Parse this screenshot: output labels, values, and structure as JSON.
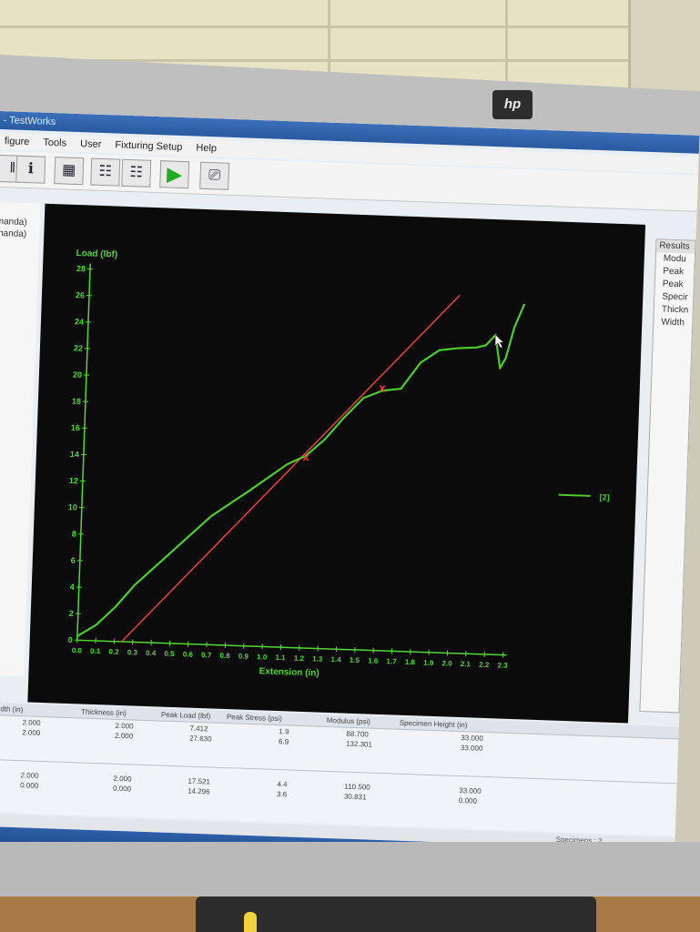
{
  "monitor_brand": "hp",
  "window": {
    "title": "- TestWorks"
  },
  "menu": [
    "figure",
    "Tools",
    "User",
    "Fixturing Setup",
    "Help"
  ],
  "toolbar_icons": [
    "fixture-icon",
    "info-icon",
    "grid-icon",
    "calculator-icon",
    "calculator-icon",
    "play-icon",
    "exit-door-icon"
  ],
  "left_panel": [
    "manda)",
    "manda)"
  ],
  "results_panel": {
    "header": "Results",
    "items": [
      "Modu",
      "Peak",
      "Peak",
      "Specir",
      "Thickn",
      "Width"
    ]
  },
  "chart_data": {
    "type": "line",
    "xlabel": "Extension (in)",
    "ylabel": "Load (lbf)",
    "xlim": [
      0,
      2.3
    ],
    "ylim": [
      0,
      28
    ],
    "x_ticks": [
      "0.0",
      "0.1",
      "0.2",
      "0.3",
      "0.4",
      "0.5",
      "0.6",
      "0.7",
      "0.8",
      "0.9",
      "1.0",
      "1.1",
      "1.2",
      "1.3",
      "1.4",
      "1.5",
      "1.6",
      "1.7",
      "1.8",
      "1.9",
      "2.0",
      "2.1",
      "2.2",
      "2.3"
    ],
    "y_ticks": [
      "0",
      "2",
      "4",
      "6",
      "8",
      "10",
      "12",
      "14",
      "16",
      "18",
      "20",
      "22",
      "24",
      "26",
      "28"
    ],
    "series": [
      {
        "name": "[2]",
        "color": "#4ccd2f",
        "x": [
          0.0,
          0.1,
          0.2,
          0.3,
          0.5,
          0.7,
          0.9,
          1.1,
          1.2,
          1.3,
          1.4,
          1.5,
          1.6,
          1.7,
          1.8,
          1.9,
          2.0,
          2.1,
          2.15,
          2.2,
          2.23,
          2.26,
          2.3,
          2.35
        ],
        "y": [
          0.3,
          1.2,
          2.6,
          4.3,
          7.0,
          9.7,
          11.7,
          13.8,
          14.5,
          15.8,
          17.5,
          19.0,
          19.6,
          19.8,
          21.8,
          22.8,
          23.0,
          23.1,
          23.3,
          24.1,
          21.6,
          22.4,
          24.7,
          26.5
        ]
      }
    ],
    "modulus_line": {
      "color": "#e6443e",
      "x": [
        0.24,
        2.0
      ],
      "y": [
        0.0,
        27.0
      ]
    },
    "markers": [
      {
        "x": 1.2,
        "y": 14.4,
        "label": "x"
      },
      {
        "x": 1.6,
        "y": 19.8,
        "label": "x"
      }
    ],
    "cursor": {
      "x": 2.2,
      "y": 24.1
    }
  },
  "table": {
    "headers": [
      "Width (in)",
      "Thickness (in)",
      "Peak Load (lbf)",
      "Peak Stress (psi)",
      "Modulus (psi)",
      "Specimen Height (in)"
    ],
    "rows": [
      [
        "2.000",
        "2.000",
        "7.412",
        "1.9",
        "88.700",
        "33.000"
      ],
      [
        "2.000",
        "2.000",
        "27.630",
        "6.9",
        "132.301",
        "33.000"
      ]
    ],
    "summary_rows": [
      [
        "2.000",
        "2.000",
        "17.521",
        "4.4",
        "110.500",
        "33.000"
      ],
      [
        "0.000",
        "0.000",
        "14.296",
        "3.6",
        "30.831",
        "0.000"
      ]
    ]
  },
  "status": {
    "specimens": "Specimens : 2"
  }
}
